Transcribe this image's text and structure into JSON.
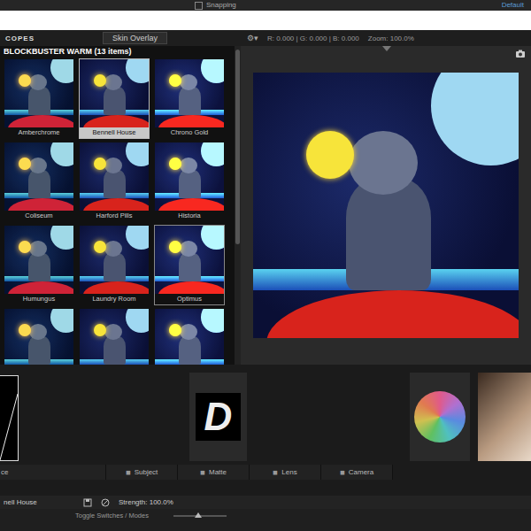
{
  "ae_toolbar": {
    "snapping": "Snapping",
    "workspace": "Default"
  },
  "header": {
    "panel": "COPES",
    "tab": "Skin Overlay",
    "readout": "R: 0.000 | G: 0.000 | B: 0.000",
    "zoom": "Zoom: 100.0%"
  },
  "browser": {
    "title": "BLOCKBUSTER WARM (13 items)",
    "items": [
      {
        "label": "Amberchrome",
        "selected": false,
        "hovered": false
      },
      {
        "label": "Bennell House",
        "selected": true,
        "hovered": false
      },
      {
        "label": "Chrono Gold",
        "selected": false,
        "hovered": false
      },
      {
        "label": "Coliseum",
        "selected": false,
        "hovered": false
      },
      {
        "label": "Harford Pills",
        "selected": false,
        "hovered": false
      },
      {
        "label": "Historia",
        "selected": false,
        "hovered": false
      },
      {
        "label": "Humungus",
        "selected": false,
        "hovered": false
      },
      {
        "label": "Laundry Room",
        "selected": false,
        "hovered": false
      },
      {
        "label": "Optimus",
        "selected": false,
        "hovered": true
      },
      {
        "label": "",
        "selected": false,
        "hovered": false
      },
      {
        "label": "",
        "selected": false,
        "hovered": false
      },
      {
        "label": "",
        "selected": false,
        "hovered": false
      }
    ]
  },
  "tools": {
    "tile_letter": "D",
    "left_label": "ce",
    "tabs": [
      {
        "label": "Subject"
      },
      {
        "label": "Matte"
      },
      {
        "label": "Lens"
      },
      {
        "label": "Camera"
      }
    ]
  },
  "status": {
    "preset": "nell House",
    "strength": "Strength: 100.0%"
  },
  "ae_bottom": {
    "toggle": "Toggle Switches / Modes"
  }
}
